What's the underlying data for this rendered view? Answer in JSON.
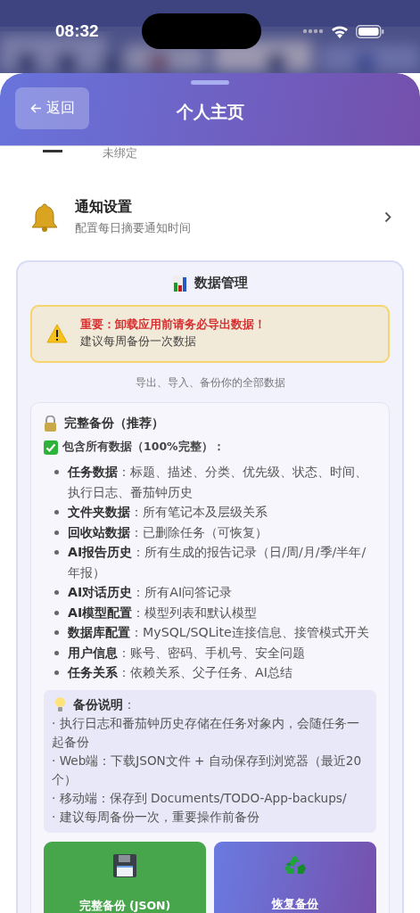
{
  "status_bar": {
    "time": "08:32"
  },
  "header": {
    "back_label": "返回",
    "title": "个人主页"
  },
  "hidden_row": {
    "subtitle": "未绑定"
  },
  "notification_row": {
    "title": "通知设置",
    "subtitle": "配置每日摘要通知时间"
  },
  "data_management": {
    "title": "数据管理",
    "warning": {
      "headline": "重要：卸载应用前请务必导出数据！",
      "text": "建议每周备份一次数据"
    },
    "caption": "导出、导入、备份你的全部数据",
    "full_backup": {
      "title": "完整备份（推荐）",
      "includes": "包含所有数据（100%完整）：",
      "items": [
        "**任务数据**：标题、描述、分类、优先级、状态、时间、执行日志、番茄钟历史",
        "**文件夹数据**：所有笔记本及层级关系",
        "**回收站数据**：已删除任务（可恢复）",
        "**AI报告历史**：所有生成的报告记录（日/周/月/季/半年/年报）",
        "**AI对话历史**：所有AI问答记录",
        "**AI模型配置**：模型列表和默认模型",
        "**数据库配置**：MySQL/SQLite连接信息、接管模式开关",
        "**用户信息**：账号、密码、手机号、安全问题",
        "**任务关系**：依赖关系、父子任务、AI总结"
      ]
    },
    "notes": {
      "title": "**备份说明**：",
      "lines": [
        "· 执行日志和番茄钟历史存储在任务对象内，会随任务一起备份",
        "· Web端：下载JSON文件 + 自动保存到浏览器（最近20个）",
        "· 移动端：保存到 Documents/TODO-App-backups/",
        "· 建议每周备份一次，重要操作前备份"
      ]
    },
    "buttons": [
      {
        "label": "完整备份 (JSON)",
        "kind": "save"
      },
      {
        "label": "恢复备份",
        "kind": "restore"
      }
    ]
  }
}
